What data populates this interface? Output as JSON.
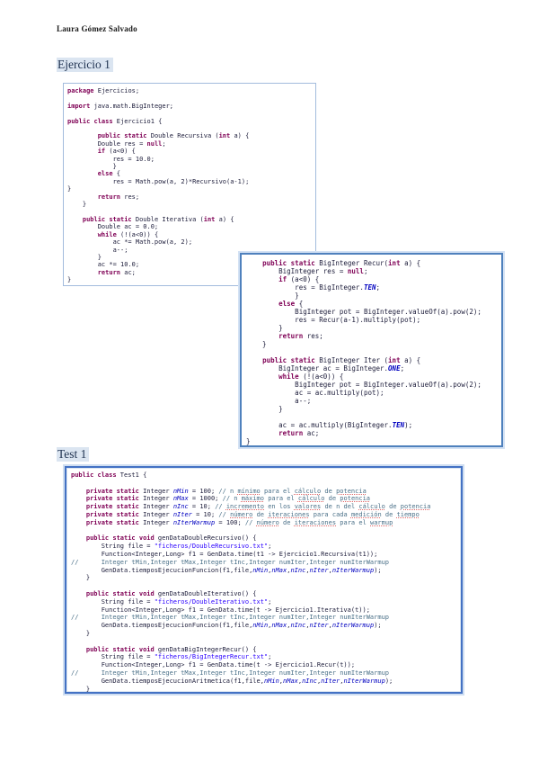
{
  "author": "Laura Gómez Salvado",
  "headings": {
    "ejercicio": "Ejercicio 1",
    "test": "Test 1"
  },
  "colors": {
    "keyword": "#7f0055",
    "string": "#2a00ff",
    "comment": "#4a7088",
    "field": "#0000c0",
    "box_border_light": "#a3bcdd",
    "box_border_strong": "#4472c4",
    "heading_highlight": "#dbe5f1"
  },
  "code_blocks": {
    "ejercicio1_main": {
      "lines": [
        [
          [
            "k",
            "package"
          ],
          [
            "t",
            " Ejercicios;"
          ]
        ],
        [],
        [
          [
            "k",
            "import"
          ],
          [
            "t",
            " java.math.BigInteger;"
          ]
        ],
        [],
        [
          [
            "k",
            "public class"
          ],
          [
            "t",
            " Ejercicio1 {"
          ]
        ],
        [],
        [
          [
            "t",
            "        "
          ],
          [
            "k",
            "public static"
          ],
          [
            "t",
            " Double Recursiva ("
          ],
          [
            "k",
            "int"
          ],
          [
            "t",
            " a) {"
          ]
        ],
        [
          [
            "t",
            "        Double res = "
          ],
          [
            "k",
            "null"
          ],
          [
            "t",
            ";"
          ]
        ],
        [
          [
            "t",
            "        "
          ],
          [
            "k",
            "if"
          ],
          [
            "t",
            " (a<0) {"
          ]
        ],
        [
          [
            "t",
            "            res = 10.0;"
          ]
        ],
        [
          [
            "t",
            "            }"
          ]
        ],
        [
          [
            "t",
            "        "
          ],
          [
            "k",
            "else"
          ],
          [
            "t",
            " {"
          ]
        ],
        [
          [
            "t",
            "            res = Math.pow(a, 2)*Recursivo(a-1);"
          ]
        ],
        [
          [
            "t",
            "}"
          ]
        ],
        [
          [
            "t",
            "        "
          ],
          [
            "k",
            "return"
          ],
          [
            "t",
            " res;"
          ]
        ],
        [
          [
            "t",
            "    }"
          ]
        ],
        [],
        [
          [
            "t",
            "    "
          ],
          [
            "k",
            "public static"
          ],
          [
            "t",
            " Double Iterativa ("
          ],
          [
            "k",
            "int"
          ],
          [
            "t",
            " a) {"
          ]
        ],
        [
          [
            "t",
            "        Double ac = 0.0;"
          ]
        ],
        [
          [
            "t",
            "        "
          ],
          [
            "k",
            "while"
          ],
          [
            "t",
            " (!(a<0)) {"
          ]
        ],
        [
          [
            "t",
            "            ac *= Math.pow(a, 2);"
          ]
        ],
        [
          [
            "t",
            "            a--;"
          ]
        ],
        [
          [
            "t",
            "        }"
          ]
        ],
        [
          [
            "t",
            "        ac *= 10.0;"
          ]
        ],
        [
          [
            "t",
            "        "
          ],
          [
            "k",
            "return"
          ],
          [
            "t",
            " ac;"
          ]
        ],
        [
          [
            "t",
            "}"
          ]
        ]
      ]
    },
    "ejercicio1_biginteger": {
      "lines": [
        [
          [
            "t",
            "    "
          ],
          [
            "k",
            "public static"
          ],
          [
            "t",
            " BigInteger Recur("
          ],
          [
            "k",
            "int"
          ],
          [
            "t",
            " a) {"
          ]
        ],
        [
          [
            "t",
            "        BigInteger res = "
          ],
          [
            "k",
            "null"
          ],
          [
            "t",
            ";"
          ]
        ],
        [
          [
            "t",
            "        "
          ],
          [
            "k",
            "if"
          ],
          [
            "t",
            " (a<0) {"
          ]
        ],
        [
          [
            "t",
            "            res = BigInteger."
          ],
          [
            "F",
            "TEN"
          ],
          [
            "t",
            ";"
          ]
        ],
        [
          [
            "t",
            "            }"
          ]
        ],
        [
          [
            "t",
            "        "
          ],
          [
            "k",
            "else"
          ],
          [
            "t",
            " {"
          ]
        ],
        [
          [
            "t",
            "            BigInteger pot = BigInteger.valueOf(a).pow(2);"
          ]
        ],
        [
          [
            "t",
            "            res = Recur(a-1).multiply(pot);"
          ]
        ],
        [
          [
            "t",
            "        }"
          ]
        ],
        [
          [
            "t",
            "        "
          ],
          [
            "k",
            "return"
          ],
          [
            "t",
            " res;"
          ]
        ],
        [
          [
            "t",
            "    }"
          ]
        ],
        [],
        [
          [
            "t",
            "    "
          ],
          [
            "k",
            "public static"
          ],
          [
            "t",
            " BigInteger Iter ("
          ],
          [
            "k",
            "int"
          ],
          [
            "t",
            " a) {"
          ]
        ],
        [
          [
            "t",
            "        BigInteger ac = BigInteger."
          ],
          [
            "F",
            "ONE"
          ],
          [
            "t",
            ";"
          ]
        ],
        [
          [
            "t",
            "        "
          ],
          [
            "k",
            "while"
          ],
          [
            "t",
            " (!(a<0)) {"
          ]
        ],
        [
          [
            "t",
            "            BigInteger pot = BigInteger.valueOf(a).pow(2);"
          ]
        ],
        [
          [
            "t",
            "            ac = ac.multiply(pot);"
          ]
        ],
        [
          [
            "t",
            "            a--;"
          ]
        ],
        [
          [
            "t",
            "        }"
          ]
        ],
        [],
        [
          [
            "t",
            "        ac = ac.multiply(BigInteger."
          ],
          [
            "F",
            "TEN"
          ],
          [
            "t",
            ");"
          ]
        ],
        [
          [
            "t",
            "        "
          ],
          [
            "k",
            "return"
          ],
          [
            "t",
            " ac;"
          ]
        ],
        [
          [
            "t",
            "}"
          ]
        ]
      ]
    },
    "test1": {
      "lines": [
        [
          [
            "k",
            "public class"
          ],
          [
            "t",
            " Test1 {"
          ]
        ],
        [],
        [
          [
            "t",
            "    "
          ],
          [
            "k",
            "private static"
          ],
          [
            "t",
            " Integer "
          ],
          [
            "f",
            "nMin"
          ],
          [
            "t",
            " = 100; "
          ],
          [
            "c",
            "// n "
          ],
          [
            "u",
            "mínimo"
          ],
          [
            "c",
            " para el "
          ],
          [
            "u",
            "cálculo"
          ],
          [
            "c",
            " de "
          ],
          [
            "u",
            "potencia"
          ]
        ],
        [
          [
            "t",
            "    "
          ],
          [
            "k",
            "private static"
          ],
          [
            "t",
            " Integer "
          ],
          [
            "f",
            "nMax"
          ],
          [
            "t",
            " = 1000; "
          ],
          [
            "c",
            "// n "
          ],
          [
            "u",
            "máximo"
          ],
          [
            "c",
            " para el "
          ],
          [
            "u",
            "cálculo"
          ],
          [
            "c",
            " de "
          ],
          [
            "u",
            "potencia"
          ]
        ],
        [
          [
            "t",
            "    "
          ],
          [
            "k",
            "private static"
          ],
          [
            "t",
            " Integer "
          ],
          [
            "f",
            "nInc"
          ],
          [
            "t",
            " = 10; "
          ],
          [
            "c",
            "// "
          ],
          [
            "u",
            "incremento"
          ],
          [
            "c",
            " en los "
          ],
          [
            "u",
            "valores"
          ],
          [
            "c",
            " de n del "
          ],
          [
            "u",
            "cálculo"
          ],
          [
            "c",
            " de "
          ],
          [
            "u",
            "potencia"
          ]
        ],
        [
          [
            "t",
            "    "
          ],
          [
            "k",
            "private static"
          ],
          [
            "t",
            " Integer "
          ],
          [
            "f",
            "nIter"
          ],
          [
            "t",
            " = 10; "
          ],
          [
            "c",
            "// "
          ],
          [
            "u",
            "número"
          ],
          [
            "c",
            " de "
          ],
          [
            "u",
            "iteraciones"
          ],
          [
            "c",
            " para cada "
          ],
          [
            "u",
            "medición"
          ],
          [
            "c",
            " de "
          ],
          [
            "u",
            "tiempo"
          ]
        ],
        [
          [
            "t",
            "    "
          ],
          [
            "k",
            "private static"
          ],
          [
            "t",
            " Integer "
          ],
          [
            "f",
            "nIterWarmup"
          ],
          [
            "t",
            " = 100; "
          ],
          [
            "c",
            "// "
          ],
          [
            "u",
            "número"
          ],
          [
            "c",
            " de "
          ],
          [
            "u",
            "iteraciones"
          ],
          [
            "c",
            " para el "
          ],
          [
            "u",
            "warmup"
          ]
        ],
        [],
        [
          [
            "t",
            "    "
          ],
          [
            "k",
            "public static void"
          ],
          [
            "t",
            " genDataDoubleRecursivo() {"
          ]
        ],
        [
          [
            "t",
            "        String file = "
          ],
          [
            "s",
            "\"ficheros/DoubleRecursivo.txt\""
          ],
          [
            "t",
            ";"
          ]
        ],
        [
          [
            "t",
            "        Function<Integer,Long> f1 = GenData.time(t1 -> Ejercicio1.Recursiva(t1));"
          ]
        ],
        [
          [
            "c",
            "//      Integer tMin,Integer tMax,Integer tInc,Integer numIter,Integer numIterWarmup"
          ]
        ],
        [
          [
            "t",
            "        GenData.tiemposEjecucionFuncion(f1,file,"
          ],
          [
            "f",
            "nMin"
          ],
          [
            "t",
            ","
          ],
          [
            "f",
            "nMax"
          ],
          [
            "t",
            ","
          ],
          [
            "f",
            "nInc"
          ],
          [
            "t",
            ","
          ],
          [
            "f",
            "nIter"
          ],
          [
            "t",
            ","
          ],
          [
            "f",
            "nIterWarmup"
          ],
          [
            "t",
            ");"
          ]
        ],
        [
          [
            "t",
            "    }"
          ]
        ],
        [],
        [
          [
            "t",
            "    "
          ],
          [
            "k",
            "public static void"
          ],
          [
            "t",
            " genDataDoubleIterativo() {"
          ]
        ],
        [
          [
            "t",
            "        String file = "
          ],
          [
            "s",
            "\"ficheros/DoubleIterativo.txt\""
          ],
          [
            "t",
            ";"
          ]
        ],
        [
          [
            "t",
            "        Function<Integer,Long> f1 = GenData.time(t -> Ejercicio1.Iterativa(t));"
          ]
        ],
        [
          [
            "c",
            "//      Integer tMin,Integer tMax,Integer tInc,Integer numIter,Integer numIterWarmup"
          ]
        ],
        [
          [
            "t",
            "        GenData.tiemposEjecucionFuncion(f1,file,"
          ],
          [
            "f",
            "nMin"
          ],
          [
            "t",
            ","
          ],
          [
            "f",
            "nMax"
          ],
          [
            "t",
            ","
          ],
          [
            "f",
            "nInc"
          ],
          [
            "t",
            ","
          ],
          [
            "f",
            "nIter"
          ],
          [
            "t",
            ","
          ],
          [
            "f",
            "nIterWarmup"
          ],
          [
            "t",
            ");"
          ]
        ],
        [
          [
            "t",
            "    }"
          ]
        ],
        [],
        [
          [
            "t",
            "    "
          ],
          [
            "k",
            "public static void"
          ],
          [
            "t",
            " genDataBigIntegerRecur() {"
          ]
        ],
        [
          [
            "t",
            "        String file = "
          ],
          [
            "s",
            "\"ficheros/BigIntegerRecur.txt\""
          ],
          [
            "t",
            ";"
          ]
        ],
        [
          [
            "t",
            "        Function<Integer,Long> f1 = GenData.time(t -> Ejercicio1.Recur(t));"
          ]
        ],
        [
          [
            "c",
            "//      Integer tMin,Integer tMax,Integer tInc,Integer numIter,Integer numIterWarmup"
          ]
        ],
        [
          [
            "t",
            "        GenData.tiemposEjecucionAritmetica(f1,file,"
          ],
          [
            "f",
            "nMin"
          ],
          [
            "t",
            ","
          ],
          [
            "f",
            "nMax"
          ],
          [
            "t",
            ","
          ],
          [
            "f",
            "nInc"
          ],
          [
            "t",
            ","
          ],
          [
            "f",
            "nIter"
          ],
          [
            "t",
            ","
          ],
          [
            "f",
            "nIterWarmup"
          ],
          [
            "t",
            ");"
          ]
        ],
        [
          [
            "t",
            "    }"
          ]
        ]
      ]
    }
  }
}
